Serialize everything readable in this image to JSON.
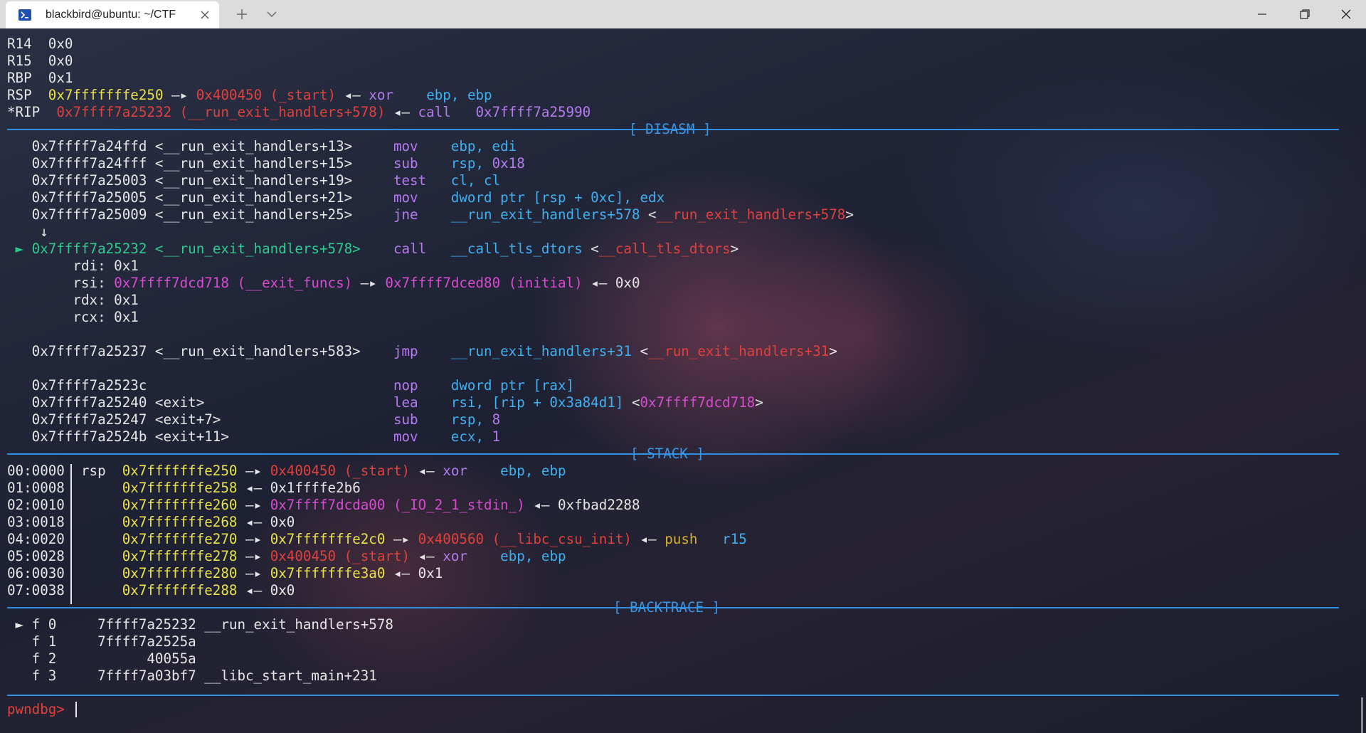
{
  "window": {
    "tab_title": "blackbird@ubuntu: ~/CTF",
    "icons": {
      "tab": "terminal-icon",
      "close": "close-icon",
      "new_tab": "plus-icon",
      "dropdown": "chevron-down-icon",
      "minimize": "minimize-icon",
      "maximize": "restore-icon",
      "close_window": "close-icon"
    }
  },
  "colors": {
    "white": "#e6e6e6",
    "yellow": "#e9e14a",
    "red": "#e0413c",
    "purple": "#b47bf0",
    "blue": "#3fb0f0",
    "magenta": "#d84bd0",
    "green": "#2ecb8e",
    "separator": "#2f8fe0"
  },
  "registers": [
    {
      "parts": [
        {
          "t": "R14  ",
          "c": "w"
        },
        {
          "t": "0x0",
          "c": "w"
        }
      ]
    },
    {
      "parts": [
        {
          "t": "R15  ",
          "c": "w"
        },
        {
          "t": "0x0",
          "c": "w"
        }
      ]
    },
    {
      "parts": [
        {
          "t": "RBP  ",
          "c": "w"
        },
        {
          "t": "0x1",
          "c": "w"
        }
      ]
    },
    {
      "parts": [
        {
          "t": "RSP  ",
          "c": "w"
        },
        {
          "t": "0x7fffffffe250",
          "c": "y"
        },
        {
          "t": " —▸ ",
          "c": "w"
        },
        {
          "t": "0x400450 (_start)",
          "c": "r"
        },
        {
          "t": " ◂— ",
          "c": "w"
        },
        {
          "t": "xor",
          "c": "p"
        },
        {
          "t": "    ebp, ebp",
          "c": "b"
        }
      ]
    },
    {
      "parts": [
        {
          "t": "*RIP  ",
          "c": "w"
        },
        {
          "t": "0x7ffff7a25232 (__run_exit_handlers+578)",
          "c": "r"
        },
        {
          "t": " ◂— ",
          "c": "w"
        },
        {
          "t": "call",
          "c": "p"
        },
        {
          "t": "   0x7ffff7a25990",
          "c": "p"
        }
      ]
    }
  ],
  "sections": {
    "disasm": "[ DISASM ]",
    "stack": "[ STACK ]",
    "backtrace": "[ BACKTRACE ]"
  },
  "disasm": [
    {
      "parts": [
        {
          "t": "   0x7ffff7a24ffd <__run_exit_handlers+13>     ",
          "c": "w"
        },
        {
          "t": "mov",
          "c": "p"
        },
        {
          "t": "    ebp, edi",
          "c": "b"
        }
      ]
    },
    {
      "parts": [
        {
          "t": "   0x7ffff7a24fff <__run_exit_handlers+15>     ",
          "c": "w"
        },
        {
          "t": "sub",
          "c": "p"
        },
        {
          "t": "    rsp, ",
          "c": "b"
        },
        {
          "t": "0x18",
          "c": "p"
        }
      ]
    },
    {
      "parts": [
        {
          "t": "   0x7ffff7a25003 <__run_exit_handlers+19>     ",
          "c": "w"
        },
        {
          "t": "test",
          "c": "p"
        },
        {
          "t": "   cl, cl",
          "c": "b"
        }
      ]
    },
    {
      "parts": [
        {
          "t": "   0x7ffff7a25005 <__run_exit_handlers+21>     ",
          "c": "w"
        },
        {
          "t": "mov",
          "c": "p"
        },
        {
          "t": "    dword ptr [rsp + 0xc], edx",
          "c": "b"
        }
      ]
    },
    {
      "parts": [
        {
          "t": "   0x7ffff7a25009 <__run_exit_handlers+25>     ",
          "c": "w"
        },
        {
          "t": "jne",
          "c": "p"
        },
        {
          "t": "    __run_exit_handlers+578",
          "c": "b"
        },
        {
          "t": " <",
          "c": "w"
        },
        {
          "t": "__run_exit_handlers+578",
          "c": "r"
        },
        {
          "t": ">",
          "c": "w"
        }
      ]
    },
    {
      "parts": [
        {
          "t": "    ↓",
          "c": "w"
        }
      ]
    },
    {
      "parts": [
        {
          "t": " ► 0x7ffff7a25232 <__run_exit_handlers+578>    ",
          "c": "g"
        },
        {
          "t": "call",
          "c": "p"
        },
        {
          "t": "   __call_tls_dtors",
          "c": "b"
        },
        {
          "t": " <",
          "c": "w"
        },
        {
          "t": "__call_tls_dtors",
          "c": "r"
        },
        {
          "t": ">",
          "c": "w"
        }
      ]
    },
    {
      "parts": [
        {
          "t": "        rdi: 0x1",
          "c": "w"
        }
      ]
    },
    {
      "parts": [
        {
          "t": "        rsi: ",
          "c": "w"
        },
        {
          "t": "0x7ffff7dcd718 (__exit_funcs)",
          "c": "m"
        },
        {
          "t": " —▸ ",
          "c": "w"
        },
        {
          "t": "0x7ffff7dced80 (initial)",
          "c": "m"
        },
        {
          "t": " ◂— 0x0",
          "c": "w"
        }
      ]
    },
    {
      "parts": [
        {
          "t": "        rdx: 0x1",
          "c": "w"
        }
      ]
    },
    {
      "parts": [
        {
          "t": "        rcx: 0x1",
          "c": "w"
        }
      ]
    },
    {
      "parts": [
        {
          "t": "",
          "c": "w"
        }
      ]
    },
    {
      "parts": [
        {
          "t": "   0x7ffff7a25237 <__run_exit_handlers+583>    ",
          "c": "w"
        },
        {
          "t": "jmp",
          "c": "p"
        },
        {
          "t": "    __run_exit_handlers+31",
          "c": "b"
        },
        {
          "t": " <",
          "c": "w"
        },
        {
          "t": "__run_exit_handlers+31",
          "c": "r"
        },
        {
          "t": ">",
          "c": "w"
        }
      ]
    },
    {
      "parts": [
        {
          "t": "",
          "c": "w"
        }
      ]
    },
    {
      "parts": [
        {
          "t": "   0x7ffff7a2523c                              ",
          "c": "w"
        },
        {
          "t": "nop",
          "c": "p"
        },
        {
          "t": "    dword ptr [rax]",
          "c": "b"
        }
      ]
    },
    {
      "parts": [
        {
          "t": "   0x7ffff7a25240 <exit>                       ",
          "c": "w"
        },
        {
          "t": "lea",
          "c": "p"
        },
        {
          "t": "    rsi, [rip + 0x3a84d1]",
          "c": "b"
        },
        {
          "t": " <",
          "c": "w"
        },
        {
          "t": "0x7ffff7dcd718",
          "c": "m"
        },
        {
          "t": ">",
          "c": "w"
        }
      ]
    },
    {
      "parts": [
        {
          "t": "   0x7ffff7a25247 <exit+7>                     ",
          "c": "w"
        },
        {
          "t": "sub",
          "c": "p"
        },
        {
          "t": "    rsp, ",
          "c": "b"
        },
        {
          "t": "8",
          "c": "p"
        }
      ]
    },
    {
      "parts": [
        {
          "t": "   0x7ffff7a2524b <exit+11>                    ",
          "c": "w"
        },
        {
          "t": "mov",
          "c": "p"
        },
        {
          "t": "    ecx, ",
          "c": "b"
        },
        {
          "t": "1",
          "c": "p"
        }
      ]
    }
  ],
  "stack": [
    {
      "parts": [
        {
          "t": "00:0000  rsp  ",
          "c": "w"
        },
        {
          "t": "0x7fffffffe250",
          "c": "y"
        },
        {
          "t": " —▸ ",
          "c": "w"
        },
        {
          "t": "0x400450 (_start)",
          "c": "r"
        },
        {
          "t": " ◂— ",
          "c": "w"
        },
        {
          "t": "xor",
          "c": "p"
        },
        {
          "t": "    ebp, ebp",
          "c": "b"
        }
      ]
    },
    {
      "parts": [
        {
          "t": "01:0008       ",
          "c": "w"
        },
        {
          "t": "0x7fffffffe258",
          "c": "y"
        },
        {
          "t": " ◂— 0x1ffffe2b6",
          "c": "w"
        }
      ]
    },
    {
      "parts": [
        {
          "t": "02:0010       ",
          "c": "w"
        },
        {
          "t": "0x7fffffffe260",
          "c": "y"
        },
        {
          "t": " —▸ ",
          "c": "w"
        },
        {
          "t": "0x7ffff7dcda00 (_IO_2_1_stdin_)",
          "c": "m"
        },
        {
          "t": " ◂— 0xfbad2288",
          "c": "w"
        }
      ]
    },
    {
      "parts": [
        {
          "t": "03:0018       ",
          "c": "w"
        },
        {
          "t": "0x7fffffffe268",
          "c": "y"
        },
        {
          "t": " ◂— 0x0",
          "c": "w"
        }
      ]
    },
    {
      "parts": [
        {
          "t": "04:0020       ",
          "c": "w"
        },
        {
          "t": "0x7fffffffe270",
          "c": "y"
        },
        {
          "t": " —▸ ",
          "c": "w"
        },
        {
          "t": "0x7fffffffe2c0",
          "c": "y"
        },
        {
          "t": " —▸ ",
          "c": "w"
        },
        {
          "t": "0x400560 (__libc_csu_init)",
          "c": "r"
        },
        {
          "t": " ◂— ",
          "c": "w"
        },
        {
          "t": "push",
          "c": "gold"
        },
        {
          "t": "   r15",
          "c": "b"
        }
      ]
    },
    {
      "parts": [
        {
          "t": "05:0028       ",
          "c": "w"
        },
        {
          "t": "0x7fffffffe278",
          "c": "y"
        },
        {
          "t": " —▸ ",
          "c": "w"
        },
        {
          "t": "0x400450 (_start)",
          "c": "r"
        },
        {
          "t": " ◂— ",
          "c": "w"
        },
        {
          "t": "xor",
          "c": "p"
        },
        {
          "t": "    ebp, ebp",
          "c": "b"
        }
      ]
    },
    {
      "parts": [
        {
          "t": "06:0030       ",
          "c": "w"
        },
        {
          "t": "0x7fffffffe280",
          "c": "y"
        },
        {
          "t": " —▸ ",
          "c": "w"
        },
        {
          "t": "0x7fffffffe3a0",
          "c": "y"
        },
        {
          "t": " ◂— 0x1",
          "c": "w"
        }
      ]
    },
    {
      "parts": [
        {
          "t": "07:0038       ",
          "c": "w"
        },
        {
          "t": "0x7fffffffe288",
          "c": "y"
        },
        {
          "t": " ◂— 0x0",
          "c": "w"
        }
      ]
    }
  ],
  "backtrace": [
    {
      "parts": [
        {
          "t": " ► f 0     7ffff7a25232 __run_exit_handlers+578",
          "c": "w"
        }
      ]
    },
    {
      "parts": [
        {
          "t": "   f 1     7ffff7a2525a",
          "c": "w"
        }
      ]
    },
    {
      "parts": [
        {
          "t": "   f 2           40055a",
          "c": "w"
        }
      ]
    },
    {
      "parts": [
        {
          "t": "   f 3     7ffff7a03bf7 __libc_start_main+231",
          "c": "w"
        }
      ]
    }
  ],
  "prompt": "pwndbg> "
}
